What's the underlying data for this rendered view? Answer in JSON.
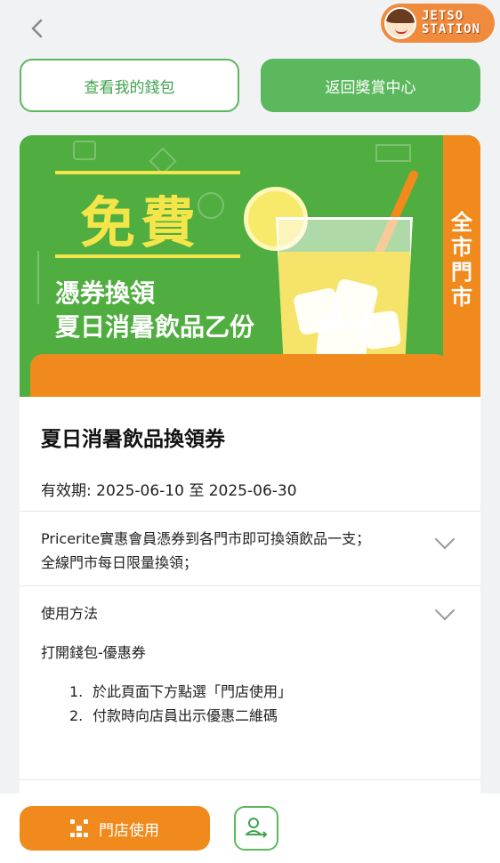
{
  "header": {
    "back_icon": "chevron-left-icon",
    "watermark_line1": "JETSO",
    "watermark_line2": "STATION"
  },
  "actions": {
    "wallet_label": "查看我的錢包",
    "rewards_label": "返回獎賞中心"
  },
  "banner": {
    "free_text": "免費",
    "line1": "憑券換領",
    "line2": "夏日消暑飲品乙份",
    "side_label": "全市門市",
    "colors": {
      "green": "#4fae3f",
      "orange": "#f08a1c",
      "yellow": "#f4e64a"
    }
  },
  "coupon": {
    "title": "夏日消暑飲品換領券",
    "validity": "有效期: 2025-06-10 至 2025-06-30",
    "description_line1": "Pricerite實惠會員憑券到各門市即可換領飲品一支；",
    "description_line2": "全線門市每日限量換領；",
    "usage_header": "使用方法",
    "usage_intro": "打開錢包-優惠券",
    "steps": [
      {
        "num": "1.",
        "text": "於此頁面下方點選「門店使用」"
      },
      {
        "num": "2.",
        "text": "付款時向店員出示優惠二維碼"
      }
    ]
  },
  "footer": {
    "use_label": "門店使用",
    "qr_icon": "qr-code-icon",
    "share_icon": "transfer-user-icon"
  }
}
